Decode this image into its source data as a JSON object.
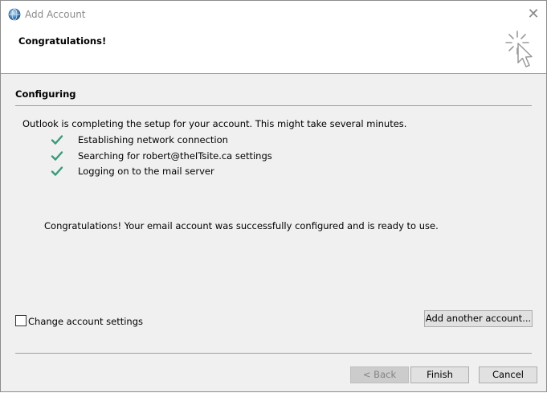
{
  "window": {
    "title": "Add Account",
    "close_icon": "close-icon"
  },
  "header": {
    "heading": "Congratulations!",
    "decoration_icon": "cursor-click-icon"
  },
  "section": {
    "title": "Configuring",
    "status": "Outlook is completing the setup for your account. This might take several minutes.",
    "steps": [
      {
        "label": "Establishing network connection",
        "icon": "check-icon",
        "state": "done"
      },
      {
        "label": "Searching for robert@theITsite.ca settings",
        "icon": "check-icon",
        "state": "done"
      },
      {
        "label": "Logging on to the mail server",
        "icon": "check-icon",
        "state": "done"
      }
    ],
    "success_message": "Congratulations! Your email account was successfully configured and is ready to use."
  },
  "options": {
    "change_settings_label": "Change account settings",
    "change_settings_checked": false,
    "add_another_label": "Add another account..."
  },
  "footer": {
    "back_label": "< Back",
    "back_enabled": false,
    "finish_label": "Finish",
    "cancel_label": "Cancel"
  },
  "colors": {
    "check": "#3a9a78",
    "dialog_bg": "#f0f0f0",
    "title_text": "#8a8a8a"
  }
}
